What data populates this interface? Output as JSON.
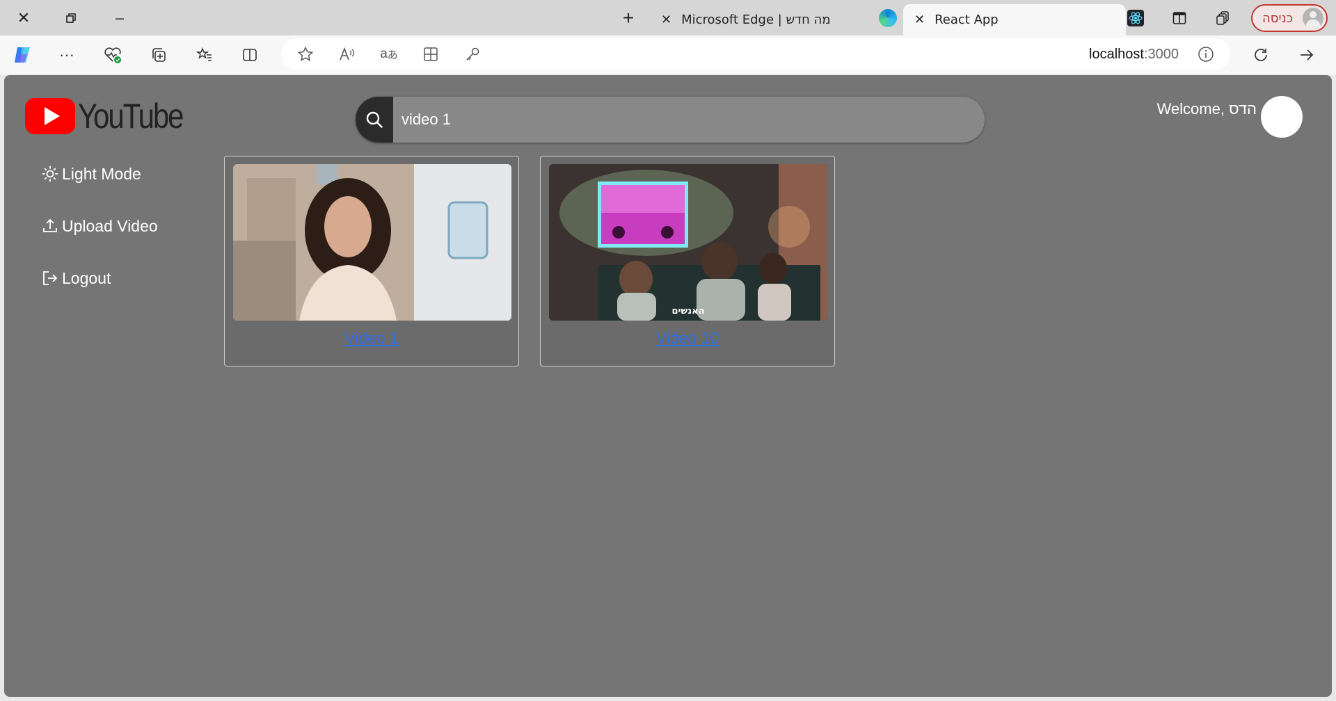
{
  "browser": {
    "tabs": [
      {
        "label": "Microsoft Edge | מה חדש"
      },
      {
        "label": "React App"
      }
    ],
    "profile_label": "כניסה",
    "url_host": "localhost",
    "url_port": ":3000"
  },
  "page": {
    "logo_text": "YouTube",
    "search": {
      "value": "video 1"
    },
    "welcome": "Welcome, הדס",
    "sidebar": [
      {
        "label": "Light Mode",
        "icon": "sun-icon"
      },
      {
        "label": "Upload Video",
        "icon": "upload-icon"
      },
      {
        "label": "Logout",
        "icon": "logout-icon"
      }
    ],
    "videos": [
      {
        "title": "Video 1"
      },
      {
        "title": "Video 10",
        "overlay_caption": "האנשים"
      }
    ]
  },
  "colors": {
    "page_bg": "#757575",
    "link": "#2f6fe6",
    "brand_red": "#ff0000"
  }
}
